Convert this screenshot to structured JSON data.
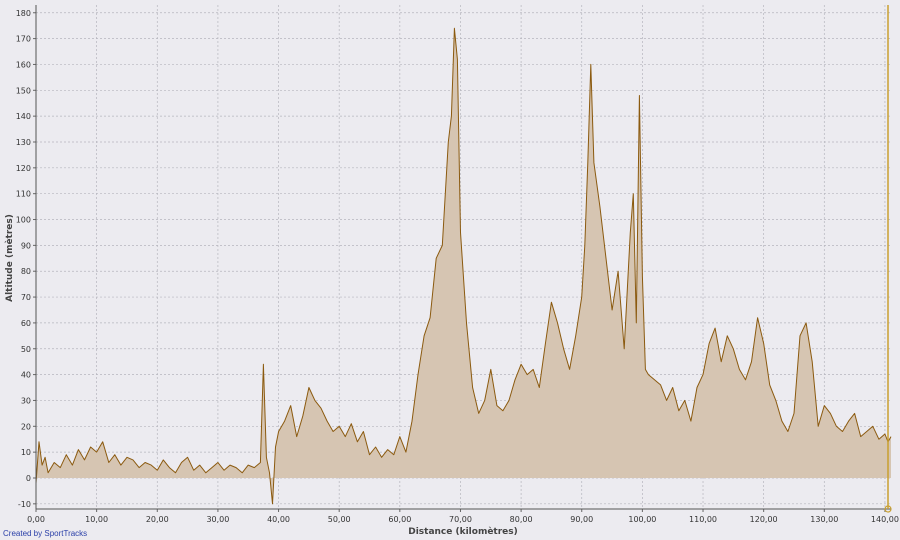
{
  "chart_data": {
    "type": "area",
    "xlabel": "Distance (kilomètres)",
    "ylabel": "Altitude (mètres)",
    "xlim": [
      0,
      141
    ],
    "ylim": [
      -12,
      183
    ],
    "x_ticks": [
      "0,00",
      "10,00",
      "20,00",
      "30,00",
      "40,00",
      "50,00",
      "60,00",
      "70,00",
      "80,00",
      "90,00",
      "100,00",
      "110,00",
      "120,00",
      "130,00",
      "140,00"
    ],
    "y_ticks": [
      "-10",
      "0",
      "10",
      "20",
      "30",
      "40",
      "50",
      "60",
      "70",
      "80",
      "90",
      "100",
      "110",
      "120",
      "130",
      "140",
      "150",
      "160",
      "170",
      "180"
    ],
    "grid": true,
    "colors": {
      "fill": "#d6c5b2",
      "line": "#8b5a0f",
      "grid": "#b5b5bd",
      "cursor": "#c9a030",
      "background": "#ecebf0"
    },
    "marker_x": 141,
    "x": [
      0,
      0.5,
      1,
      1.5,
      2,
      3,
      4,
      5,
      6,
      7,
      8,
      9,
      10,
      11,
      12,
      13,
      14,
      15,
      16,
      17,
      18,
      19,
      20,
      21,
      22,
      23,
      24,
      25,
      26,
      27,
      28,
      29,
      30,
      31,
      32,
      33,
      34,
      35,
      36,
      37,
      37.5,
      38,
      38.5,
      39,
      39.5,
      40,
      41,
      42,
      43,
      44,
      45,
      46,
      47,
      48,
      49,
      50,
      51,
      52,
      53,
      54,
      55,
      56,
      57,
      58,
      59,
      60,
      61,
      62,
      63,
      64,
      65,
      66,
      67,
      68,
      68.5,
      69,
      69.5,
      70,
      71,
      72,
      73,
      74,
      75,
      76,
      77,
      78,
      79,
      80,
      81,
      82,
      83,
      84,
      85,
      86,
      87,
      88,
      89,
      90,
      90.5,
      91,
      91.5,
      92,
      93,
      94,
      95,
      96,
      97,
      98,
      98.5,
      99,
      99.5,
      100,
      100.5,
      101,
      102,
      103,
      104,
      105,
      106,
      107,
      108,
      109,
      110,
      111,
      112,
      113,
      114,
      115,
      116,
      117,
      118,
      119,
      120,
      121,
      122,
      123,
      124,
      125,
      126,
      127,
      128,
      129,
      130,
      131,
      132,
      133,
      134,
      135,
      136,
      137,
      138,
      139,
      140,
      140.5,
      141
    ],
    "y": [
      -2,
      14,
      5,
      8,
      2,
      6,
      4,
      9,
      5,
      11,
      7,
      12,
      10,
      14,
      6,
      9,
      5,
      8,
      7,
      4,
      6,
      5,
      3,
      7,
      4,
      2,
      6,
      8,
      3,
      5,
      2,
      4,
      6,
      3,
      5,
      4,
      2,
      5,
      4,
      6,
      44,
      8,
      2,
      -10,
      12,
      18,
      22,
      28,
      16,
      24,
      35,
      30,
      27,
      22,
      18,
      20,
      16,
      21,
      14,
      18,
      9,
      12,
      8,
      11,
      9,
      16,
      10,
      22,
      40,
      55,
      62,
      85,
      90,
      130,
      140,
      174,
      162,
      95,
      60,
      35,
      25,
      30,
      42,
      28,
      26,
      30,
      38,
      44,
      40,
      42,
      35,
      52,
      68,
      60,
      50,
      42,
      55,
      70,
      90,
      122,
      160,
      122,
      105,
      85,
      65,
      80,
      50,
      95,
      110,
      60,
      148,
      78,
      42,
      40,
      38,
      36,
      30,
      35,
      26,
      30,
      22,
      35,
      40,
      52,
      58,
      45,
      55,
      50,
      42,
      38,
      45,
      62,
      52,
      36,
      30,
      22,
      18,
      25,
      55,
      60,
      45,
      20,
      28,
      25,
      20,
      18,
      22,
      25,
      16,
      18,
      20,
      15,
      17,
      14,
      16,
      20,
      12,
      6,
      13,
      8
    ]
  },
  "credit": "Created by SportTracks"
}
